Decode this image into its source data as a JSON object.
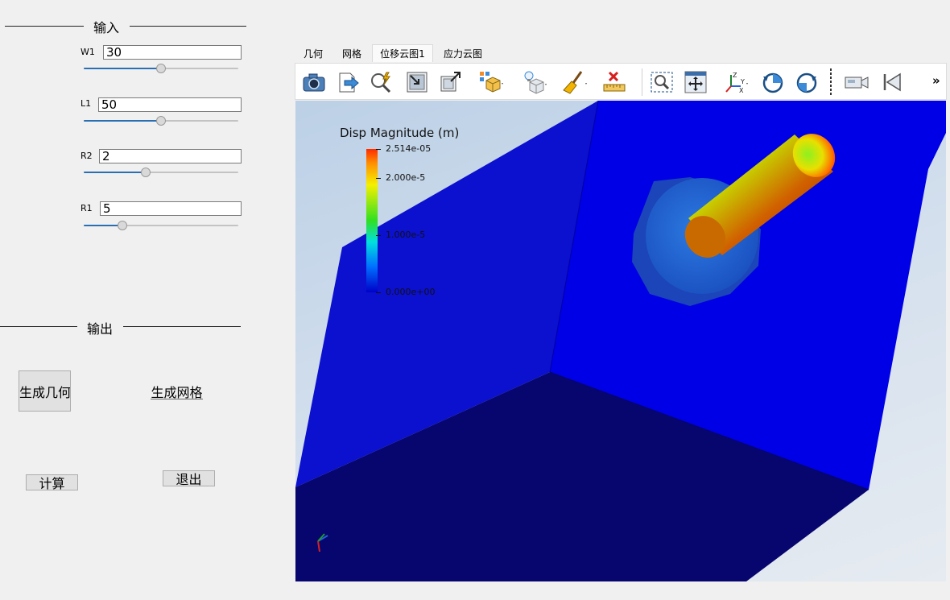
{
  "input_group": {
    "title": "输入"
  },
  "params": [
    {
      "label": "W1",
      "value": "30",
      "slider": 0.5
    },
    {
      "label": "L1",
      "value": "50",
      "slider": 0.5
    },
    {
      "label": "R2",
      "value": "2",
      "slider": 0.4
    },
    {
      "label": "R1",
      "value": "5",
      "slider": 0.25
    }
  ],
  "output_group": {
    "title": "输出"
  },
  "buttons": {
    "gen_geometry": "生成几何",
    "gen_mesh": "生成网格",
    "compute": "计算",
    "exit": "退出"
  },
  "tabs": [
    "几何",
    "网格",
    "位移云图1",
    "应力云图"
  ],
  "active_tab": 2,
  "toolbar": {
    "icons": [
      "camera-icon",
      "save-data-icon",
      "zoom-auto-icon",
      "zoom-extent-icon",
      "zoom-out-icon",
      "display-mode-icon",
      "lighting-icon",
      "clear-icon",
      "ruler-delete-icon",
      "zoom-window-icon",
      "pan-fit-icon",
      "axis-view-icon",
      "rotate-cw-icon",
      "rotate-ccw-icon",
      "camera-video-icon",
      "first-frame-icon"
    ],
    "overflow": "»"
  },
  "legend": {
    "title": "Disp Magnitude (m)",
    "labels": [
      "2.514e-05",
      "2.000e-5",
      "1.000e-5",
      "0.000e+00"
    ],
    "values": [
      2.514e-05,
      2e-05,
      1e-05,
      0.0
    ]
  },
  "colors": {
    "accent": "#2a6fb4",
    "box_face_front": "#0a0ad0",
    "box_face_right": "#0000e8",
    "box_face_bottom": "#06066a"
  }
}
